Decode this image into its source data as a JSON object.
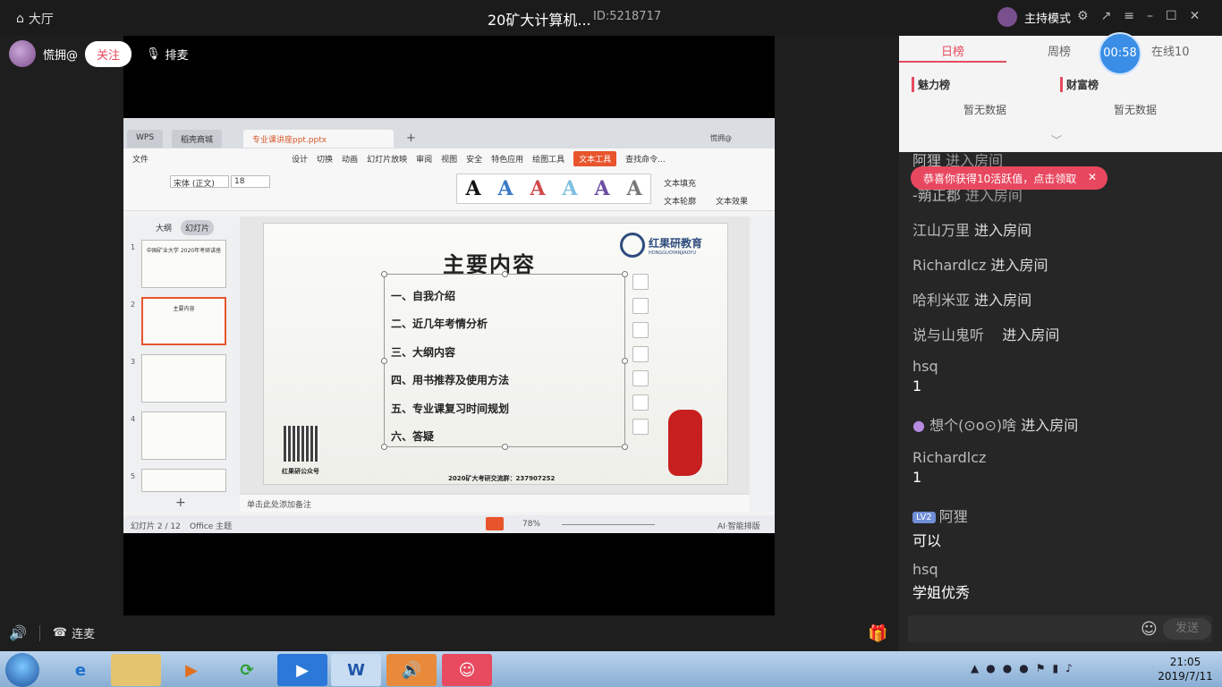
{
  "topbar": {
    "lobby": "大厅",
    "title": "20矿大计算机...",
    "room_id": "ID:5218717",
    "host_mode": "主持模式"
  },
  "streamer": {
    "name": "慌拥@",
    "follow": "关注",
    "mic_queue": "排麦"
  },
  "wps": {
    "tabs": [
      "WPS",
      "稻壳商城",
      "专业课讲座ppt.pptx"
    ],
    "user": "慌拥@",
    "menu": [
      "文件",
      "设计",
      "切换",
      "动画",
      "幻灯片放映",
      "审阅",
      "视图",
      "安全",
      "特色应用",
      "绘图工具",
      "文本工具",
      "查找命令..."
    ],
    "font_name": "宋体 (正文)",
    "font_size": "18",
    "ribbon_right": [
      "文本填充",
      "文本轮廓",
      "文本效果"
    ],
    "side_tabs": [
      "大纲",
      "幻灯片"
    ],
    "notes_placeholder": "单击此处添加备注",
    "status_left": "幻灯片 2 / 12",
    "status_theme": "Office 主题",
    "zoom": "78%",
    "ai_label": "AI·智能排版"
  },
  "slide": {
    "title": "主要内容",
    "items": [
      "一、自我介绍",
      "二、近几年考情分析",
      "三、大纲内容",
      "四、用书推荐及使用方法",
      "五、专业课复习时间规划",
      "六、答疑"
    ],
    "logo_cn": "红果研教育",
    "logo_en": "HONGGUOYANJIAOYU",
    "qr_label": "红果研公众号",
    "group": "2020矿大考研交流群：237907252"
  },
  "thumbs": [
    {
      "num": "1",
      "text": "中国矿业大学 2020年考研讲座"
    },
    {
      "num": "2",
      "text": "主要内容"
    },
    {
      "num": "3",
      "text": ""
    },
    {
      "num": "4",
      "text": ""
    },
    {
      "num": "5",
      "text": ""
    }
  ],
  "rank": {
    "tabs": [
      "日榜",
      "周榜",
      "在线10"
    ],
    "charm": "魅力榜",
    "wealth": "财富榜",
    "no_data": "暂无数据"
  },
  "timer": "00:58",
  "chat": {
    "badge": "恭喜你获得10活跃值，点击领取",
    "messages": [
      {
        "name": "阿狸",
        "text": "进入房间"
      },
      {
        "name": "-蒴正郡",
        "text": "进入房间"
      },
      {
        "name": "江山万里",
        "text": "进入房间"
      },
      {
        "name": "Richardlcz",
        "text": "进入房间"
      },
      {
        "name": "哈利米亚",
        "text": "进入房间"
      },
      {
        "name": "说与山鬼听",
        "text": "进入房间"
      },
      {
        "name": "hsq",
        "text": "1"
      },
      {
        "name": "想个(⊙o⊙)啥",
        "text": "进入房间"
      },
      {
        "name": "Richardlcz",
        "text": "1"
      },
      {
        "name": "阿狸",
        "text": "可以",
        "level": "LV2"
      },
      {
        "name": "hsq",
        "text": "学姐优秀"
      }
    ],
    "send": "发送"
  },
  "bottom": {
    "lianmai": "连麦"
  },
  "clock": {
    "time": "21:05",
    "date": "2019/7/11"
  }
}
